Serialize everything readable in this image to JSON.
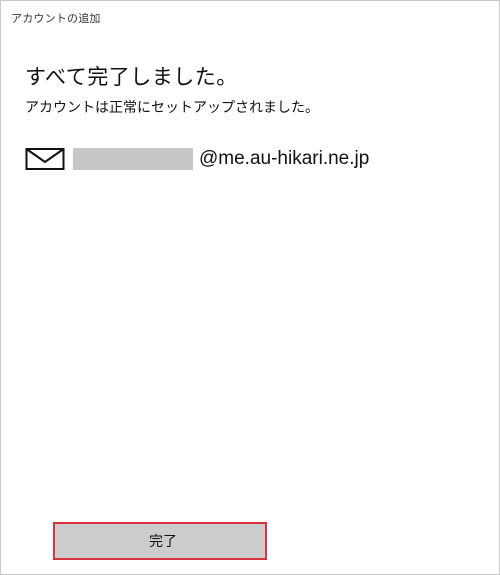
{
  "window": {
    "title": "アカウントの追加"
  },
  "main": {
    "heading": "すべて完了しました。",
    "subheading": "アカウントは正常にセットアップされました。",
    "account": {
      "icon": "mail-icon",
      "domain": "@me.au-hikari.ne.jp"
    }
  },
  "footer": {
    "done_label": "完了",
    "done_highlight_color": "#d9333f"
  }
}
